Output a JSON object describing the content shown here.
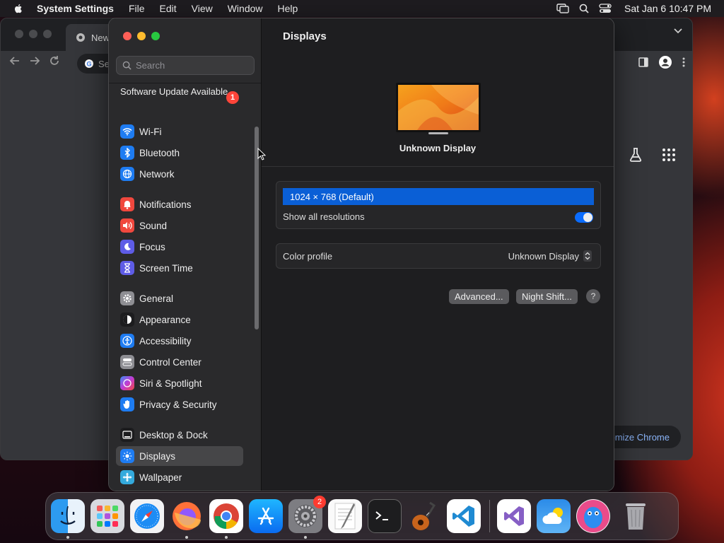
{
  "menubar": {
    "app_name": "System Settings",
    "menus": [
      "File",
      "Edit",
      "View",
      "Window",
      "Help"
    ],
    "clock": "Sat Jan 6  10:47 PM"
  },
  "chrome": {
    "tab_title": "New",
    "omnibox_partial": "Se",
    "customize_label": "omize Chrome"
  },
  "sidebar": {
    "search_placeholder": "Search",
    "update_label": "Software Update Available",
    "update_badge": "1",
    "items": [
      {
        "label": "Wi-Fi",
        "icon": "wifi-icon",
        "color": "#1e7cf2"
      },
      {
        "label": "Bluetooth",
        "icon": "bluetooth-icon",
        "color": "#1e7cf2"
      },
      {
        "label": "Network",
        "icon": "globe-icon",
        "color": "#1e7cf2"
      },
      {
        "label": "Notifications",
        "icon": "bell-icon",
        "color": "#f0483e"
      },
      {
        "label": "Sound",
        "icon": "speaker-icon",
        "color": "#f0483e"
      },
      {
        "label": "Focus",
        "icon": "moon-icon",
        "color": "#5e5ce6"
      },
      {
        "label": "Screen Time",
        "icon": "hourglass-icon",
        "color": "#5e5ce6"
      },
      {
        "label": "General",
        "icon": "gear-icon",
        "color": "#8e8e93"
      },
      {
        "label": "Appearance",
        "icon": "appearance-icon",
        "color": "#1c1c1e"
      },
      {
        "label": "Accessibility",
        "icon": "accessibility-icon",
        "color": "#1e7cf2"
      },
      {
        "label": "Control Center",
        "icon": "control-center-icon",
        "color": "#8e8e93"
      },
      {
        "label": "Siri & Spotlight",
        "icon": "siri-icon",
        "color": "#c23bd4"
      },
      {
        "label": "Privacy & Security",
        "icon": "hand-icon",
        "color": "#1e7cf2"
      },
      {
        "label": "Desktop & Dock",
        "icon": "dock-icon",
        "color": "#1c1c1e"
      },
      {
        "label": "Displays",
        "icon": "sun-icon",
        "color": "#1e7cf2"
      },
      {
        "label": "Wallpaper",
        "icon": "wallpaper-icon",
        "color": "#34aadc"
      }
    ],
    "selected": "Displays"
  },
  "main": {
    "title": "Displays",
    "display_name": "Unknown Display",
    "resolution_selected": "1024 × 768 (Default)",
    "show_all_label": "Show all resolutions",
    "show_all_enabled": true,
    "color_profile_label": "Color profile",
    "color_profile_value": "Unknown Display",
    "advanced_label": "Advanced...",
    "night_shift_label": "Night Shift...",
    "help_label": "?"
  },
  "dock": {
    "apps": [
      "Finder",
      "Launchpad",
      "Safari",
      "Firefox",
      "Chrome",
      "App Store",
      "System Settings",
      "TextEdit",
      "Terminal",
      "GarageBand",
      "VS Code",
      "Visual Studio",
      "Weather",
      "Cloud App",
      "Trash"
    ],
    "system_settings_badge": "2"
  }
}
